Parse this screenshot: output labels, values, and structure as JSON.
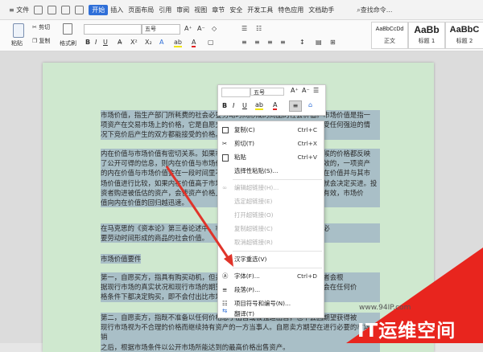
{
  "menubar": {
    "file": "≡ 文件",
    "tabs": [
      "开始",
      "插入",
      "页面布局",
      "引用",
      "审阅",
      "视图",
      "章节",
      "安全",
      "开发工具",
      "特色应用",
      "文档助手"
    ],
    "search": "查找命令..."
  },
  "ribbon": {
    "paste": "粘贴",
    "cut": "剪切",
    "copy": "复制",
    "format_painter": "格式刷",
    "font_size": "五号",
    "styles": [
      {
        "preview": "AaBbCcDd",
        "name": "正文"
      },
      {
        "preview": "AaBb",
        "name": "标题 1"
      },
      {
        "preview": "AaBbC",
        "name": "标题 2"
      }
    ]
  },
  "mini_toolbar": {
    "font_size": "五号"
  },
  "document": {
    "p1": [
      "市场价值，指生产部门所耗费的社会必要劳动时间形成的商品的社会价值。市场价值是指一",
      "项资产在交易市场上的价格，它是自愿交易的买卖双方在各自理性行事且未受任何强迫的情",
      "况下竞价后产生的双方都能接受的价格。"
    ],
    "p2": [
      "内在价值与市场价值有密切关系。如果市场是有效的，即所有资产在任何时候的价格都反映",
      "了公开可得的信息，则内在价值与市场价值应当相等。如果市场不是完全有效的，一项资产",
      "的内在价值与市场价值会在一段时间里不相等。投资者估计了一种资产的内在价值并与其市",
      "场价值进行比较，如果内在价值高于市场价值则认为资产被市场低估了，他就会决定买进。投",
      "资者购进被低估的资产，会使资产价格上升，回归到它的内在价值。市场越有效，市场价",
      "值向内在价值的回归越迅速。"
    ],
    "p3": [
      "在马克思的《资本论》第三卷论述中，市场价值是指生产部门所耗费的社会必",
      "要劳动时间形成的商品的社会价值。"
    ],
    "heading": "市场价值要件",
    "p4": [
      "第一，自愿买方，指具有购买动机，但并没有被迫进行购买的一方。该购买者会根",
      "据现行市场的真实状况和现行市场的期望值进行购买，不会急于购买，也不会在任何价",
      "格条件下都决定购买，即不会付出比市场价格更高的价格。"
    ],
    "p5": [
      "第二，自愿卖方，指既不准备以任何价格急于出售或被强迫出售，也不会因期望获得被",
      "现行市场视为不合理的价格而继续持有资产的一方当事人。自愿卖方期望在进行必要的市场营销",
      "之后，根据市场条件以公开市场所能达到的最高价格出售资产。"
    ]
  },
  "context_menu": [
    {
      "label": "复制(C)",
      "shortcut": "Ctrl+C",
      "icon": "copy-icon",
      "disabled": false
    },
    {
      "label": "剪切(T)",
      "shortcut": "Ctrl+X",
      "icon": "scissors-icon",
      "disabled": false
    },
    {
      "label": "粘贴",
      "shortcut": "Ctrl+V",
      "icon": "paste-icon",
      "disabled": false
    },
    {
      "label": "选择性粘贴(S)...",
      "shortcut": "",
      "icon": "",
      "disabled": false
    },
    {
      "label": "编辑超链接(H)...",
      "shortcut": "",
      "icon": "link-icon",
      "disabled": true
    },
    {
      "label": "选定超链接(E)",
      "shortcut": "",
      "icon": "",
      "disabled": true
    },
    {
      "label": "打开超链接(O)",
      "shortcut": "",
      "icon": "",
      "disabled": true
    },
    {
      "label": "复制超链接(C)",
      "shortcut": "",
      "icon": "",
      "disabled": true
    },
    {
      "label": "取消超链接(R)",
      "shortcut": "",
      "icon": "",
      "disabled": true
    },
    {
      "label": "汉字重选(V)",
      "shortcut": "",
      "icon": "",
      "disabled": false
    },
    {
      "label": "字体(F)...",
      "shortcut": "Ctrl+D",
      "icon": "font-icon",
      "disabled": false
    },
    {
      "label": "段落(P)...",
      "shortcut": "",
      "icon": "paragraph-icon",
      "disabled": false
    },
    {
      "label": "项目符号和编号(N)...",
      "shortcut": "",
      "icon": "list-icon",
      "disabled": false
    },
    {
      "label": "翻译(T)",
      "shortcut": "",
      "icon": "translate-icon",
      "disabled": false
    }
  ],
  "watermark": {
    "url": "www.94IP.com",
    "brand": "IT运维空间"
  },
  "colors": {
    "page": "#cfe8cf",
    "highlight": "#a9bfc7",
    "accent": "#2f6fd8",
    "brand": "#e8251e"
  }
}
